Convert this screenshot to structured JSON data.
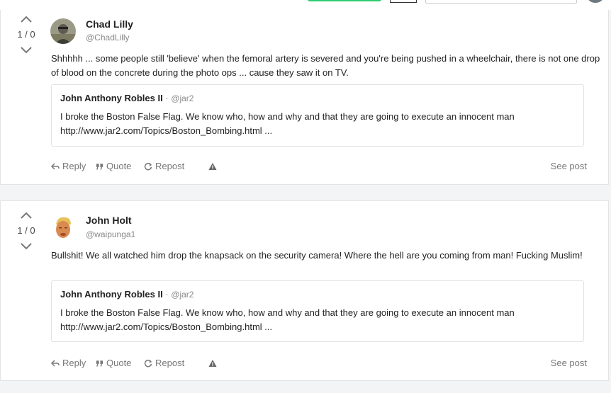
{
  "posts": [
    {
      "vote": "1 / 0",
      "author": "Chad Lilly",
      "handle": "@ChadLilly",
      "text": "Shhhhh ... some people still 'believe' when the femoral artery is severed and you're being pushed in a wheelchair, there is not one drop of blood on the concrete during the photo ops ... cause they saw it on TV.",
      "quote": {
        "author": "John Anthony Robles II",
        "separator": "·",
        "handle": "@jar2",
        "text": "I broke the Boston False Flag. We know who, how and why and that they are going to execute an innocent man http://www.jar2.com/Topics/Boston_Bombing.html ..."
      }
    },
    {
      "vote": "1 / 0",
      "author": "John Holt",
      "handle": "@waipunga1",
      "text": "Bullshit! We all watched him drop the knapsack on the security camera! Where the hell are you coming from man! Fucking Muslim!",
      "quote": {
        "author": "John Anthony Robles II",
        "separator": "·",
        "handle": "@jar2",
        "text": "I broke the Boston False Flag. We know who, how and why and that they are going to execute an innocent man http://www.jar2.com/Topics/Boston_Bombing.html ..."
      }
    }
  ],
  "actions": {
    "reply": "Reply",
    "quote": "Quote",
    "repost": "Repost",
    "see_post": "See post"
  },
  "icons": {
    "upvote": "chevron-up-icon",
    "downvote": "chevron-down-icon",
    "reply": "reply-arrow-icon",
    "quote": "quote-icon",
    "repost": "repost-icon",
    "report": "warning-triangle-icon"
  },
  "colors": {
    "page_background": "#f3f4f6",
    "card_background": "#ffffff",
    "accent_green": "#2ecc71",
    "muted_text": "#777777"
  }
}
